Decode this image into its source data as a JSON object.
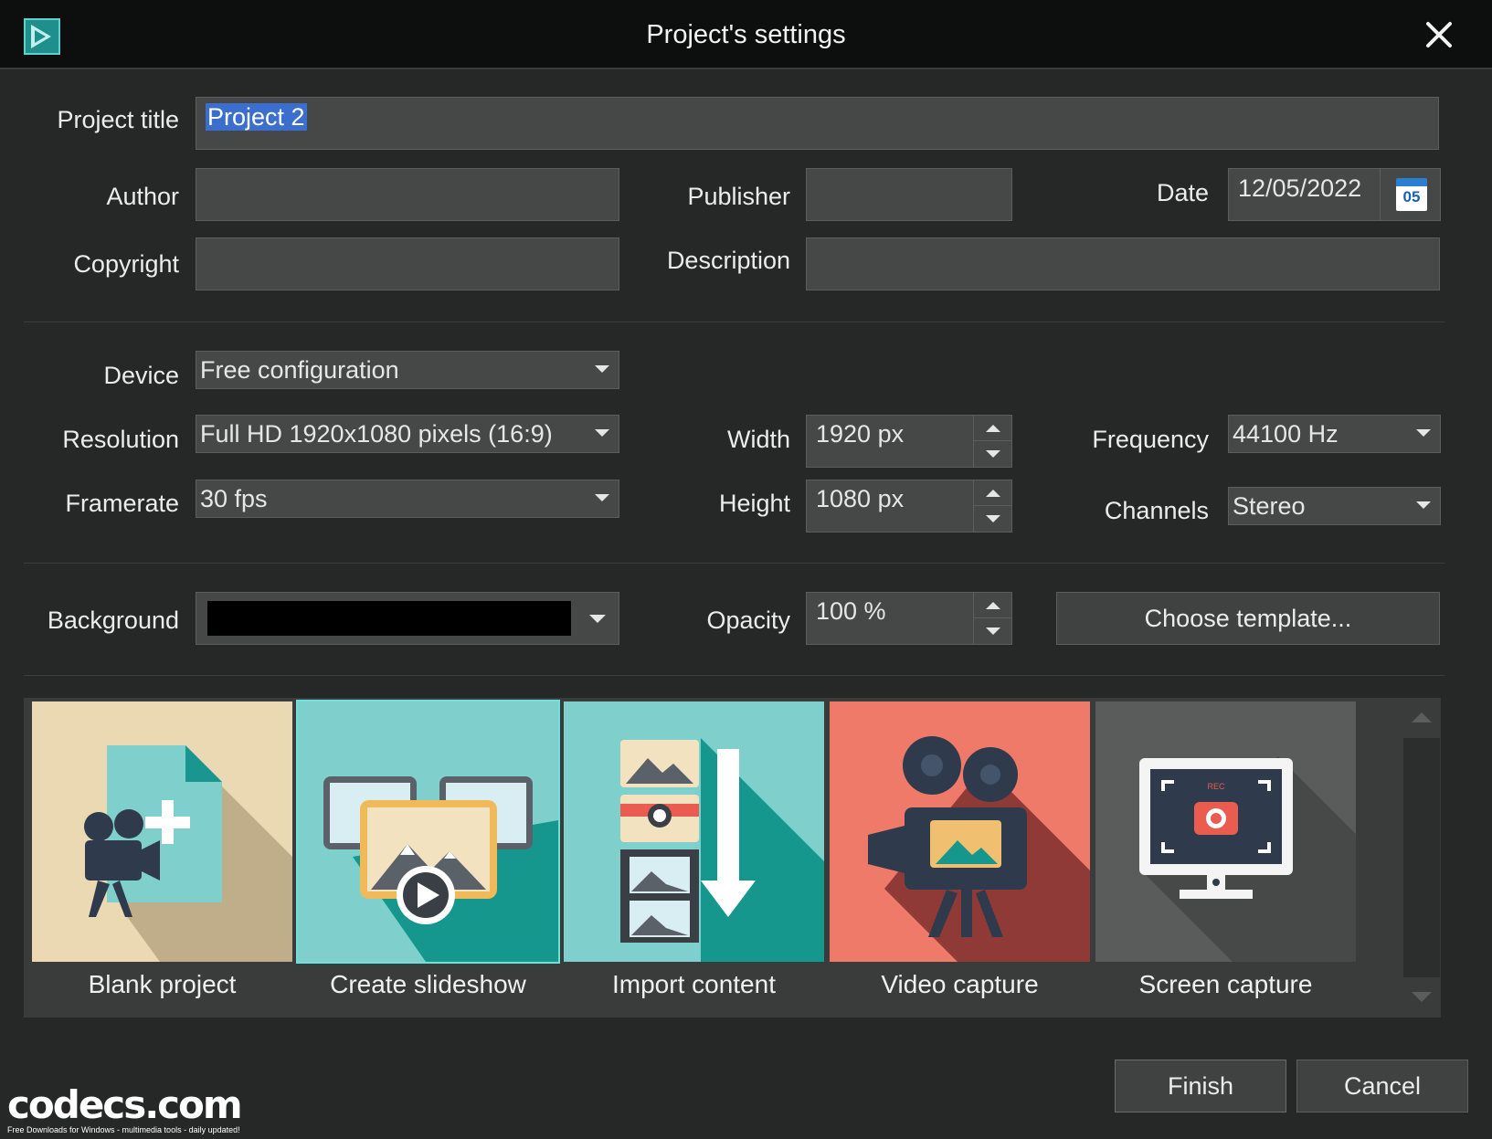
{
  "window": {
    "title": "Project's settings"
  },
  "form": {
    "project_title_label": "Project title",
    "project_title_value": "Project 2",
    "author_label": "Author",
    "author_value": "",
    "publisher_label": "Publisher",
    "publisher_value": "",
    "date_label": "Date",
    "date_value": "12/05/2022",
    "calendar_day": "05",
    "copyright_label": "Copyright",
    "copyright_value": "",
    "description_label": "Description",
    "description_value": ""
  },
  "video": {
    "device_label": "Device",
    "device_value": "Free configuration",
    "resolution_label": "Resolution",
    "resolution_value": "Full HD 1920x1080 pixels (16:9)",
    "framerate_label": "Framerate",
    "framerate_value": "30 fps",
    "width_label": "Width",
    "width_value": "1920 px",
    "height_label": "Height",
    "height_value": "1080 px",
    "frequency_label": "Frequency",
    "frequency_value": "44100 Hz",
    "channels_label": "Channels",
    "channels_value": "Stereo"
  },
  "appearance": {
    "background_label": "Background",
    "background_color": "#000000",
    "opacity_label": "Opacity",
    "opacity_value": "100 %",
    "template_button": "Choose template..."
  },
  "tiles": [
    {
      "label": "Blank project"
    },
    {
      "label": "Create slideshow"
    },
    {
      "label": "Import content"
    },
    {
      "label": "Video capture"
    },
    {
      "label": "Screen capture"
    }
  ],
  "footer": {
    "finish_label": "Finish",
    "cancel_label": "Cancel"
  },
  "watermark": {
    "logo_text": "codecs.com",
    "tagline": "Free Downloads for Windows - multimedia tools - daily updated!"
  },
  "colors": {
    "accent": "#1f8f8e",
    "selection": "#3a6fd0",
    "background": "#252827"
  }
}
